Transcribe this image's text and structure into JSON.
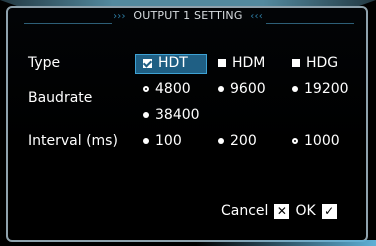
{
  "title": "OUTPUT 1 SETTING",
  "type": {
    "label": "Type",
    "options": [
      "HDT",
      "HDM",
      "HDG"
    ],
    "selected": "HDT"
  },
  "baudrate": {
    "label": "Baudrate",
    "options": [
      "4800",
      "9600",
      "19200",
      "38400"
    ],
    "selected": "4800"
  },
  "interval": {
    "label": "Interval (ms)",
    "options": [
      "100",
      "200",
      "1000"
    ],
    "selected": "1000"
  },
  "footer": {
    "cancel_label": "Cancel",
    "ok_label": "OK"
  },
  "colors": {
    "accent": "#1f5f84",
    "frame": "#8fa2ad",
    "background": "#000000"
  }
}
